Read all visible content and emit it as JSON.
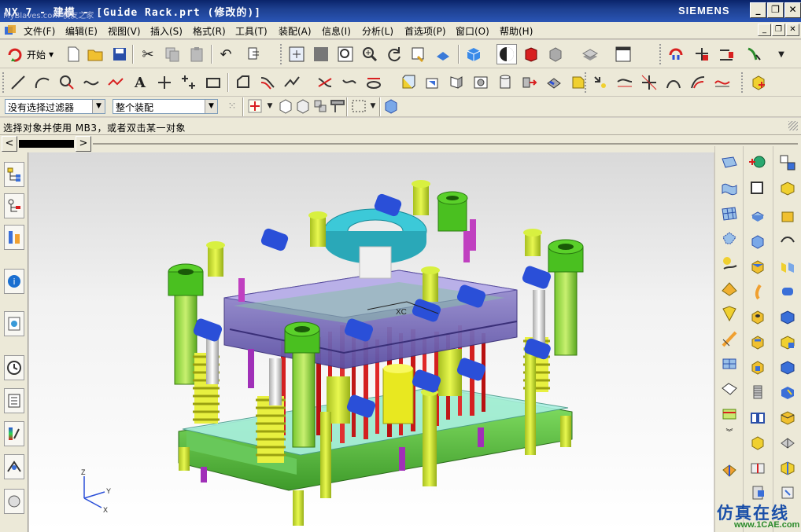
{
  "window": {
    "title": "NX 7 - 建模 - [Guide Rack.prt (修改的)]",
    "watermark": "MyBlaves.com 模友之家",
    "brand": "SIEMENS"
  },
  "menu": [
    "文件(F)",
    "编辑(E)",
    "视图(V)",
    "插入(S)",
    "格式(R)",
    "工具(T)",
    "装配(A)",
    "信息(I)",
    "分析(L)",
    "首选项(P)",
    "窗口(O)",
    "帮助(H)"
  ],
  "toolbar": {
    "start_label": "开始",
    "filter_value": "没有选择过滤器",
    "scope_value": "整个装配"
  },
  "cue": "选择对象并使用 MB3，或者双击某一对象",
  "axis": {
    "x": "X",
    "y": "Y",
    "z": "Z",
    "wcs": "XC"
  },
  "logo": {
    "cn": "仿真在线",
    "en": "www.1CAE.com"
  },
  "colors": {
    "titlebar": "#0a246a",
    "plate_purple": "#7a6fb5",
    "plate_green": "#67c947",
    "ring_cyan": "#3cc9d8",
    "screw_blue": "#2a4fd8",
    "pin_lime": "#c8e02c",
    "pin_red": "#d42020"
  }
}
